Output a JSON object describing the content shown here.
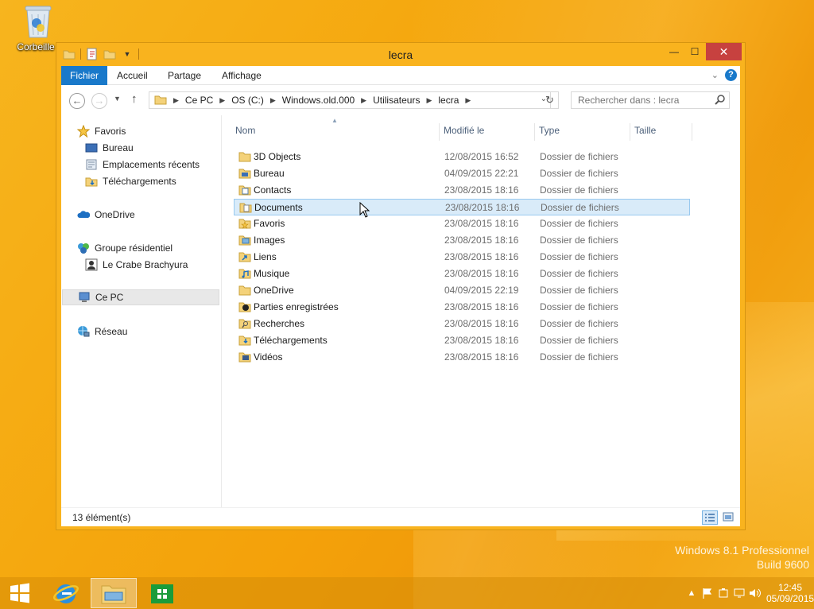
{
  "desktop": {
    "recycle_bin_label": "Corbeille",
    "watermark_line1": "Windows 8.1 Professionnel",
    "watermark_line2": "Build 9600"
  },
  "window": {
    "title": "lecra",
    "controls": {
      "minimize": "—",
      "maximize": "☐",
      "close": "✕"
    }
  },
  "ribbon": {
    "tabs": [
      {
        "label": "Fichier"
      },
      {
        "label": "Accueil"
      },
      {
        "label": "Partage"
      },
      {
        "label": "Affichage"
      }
    ],
    "help": "?"
  },
  "address": {
    "segments": [
      "Ce PC",
      "OS (C:)",
      "Windows.old.000",
      "Utilisateurs",
      "lecra"
    ],
    "search_placeholder": "Rechercher dans : lecra"
  },
  "nav": {
    "favorites_label": "Favoris",
    "favorites": [
      "Bureau",
      "Emplacements récents",
      "Téléchargements"
    ],
    "onedrive": "OneDrive",
    "homegroup": "Groupe résidentiel",
    "homegroup_user": "Le Crabe Brachyura",
    "this_pc": "Ce PC",
    "network": "Réseau"
  },
  "columns": {
    "name": "Nom",
    "modified": "Modifié le",
    "type": "Type",
    "size": "Taille"
  },
  "files": [
    {
      "name": "3D Objects",
      "date": "12/08/2015 16:52",
      "type": "Dossier de fichiers",
      "icon": "folder-icon"
    },
    {
      "name": "Bureau",
      "date": "04/09/2015 22:21",
      "type": "Dossier de fichiers",
      "icon": "desktop-folder-icon"
    },
    {
      "name": "Contacts",
      "date": "23/08/2015 18:16",
      "type": "Dossier de fichiers",
      "icon": "contacts-folder-icon"
    },
    {
      "name": "Documents",
      "date": "23/08/2015 18:16",
      "type": "Dossier de fichiers",
      "icon": "documents-folder-icon"
    },
    {
      "name": "Favoris",
      "date": "23/08/2015 18:16",
      "type": "Dossier de fichiers",
      "icon": "favorites-folder-icon"
    },
    {
      "name": "Images",
      "date": "23/08/2015 18:16",
      "type": "Dossier de fichiers",
      "icon": "pictures-folder-icon"
    },
    {
      "name": "Liens",
      "date": "23/08/2015 18:16",
      "type": "Dossier de fichiers",
      "icon": "links-folder-icon"
    },
    {
      "name": "Musique",
      "date": "23/08/2015 18:16",
      "type": "Dossier de fichiers",
      "icon": "music-folder-icon"
    },
    {
      "name": "OneDrive",
      "date": "04/09/2015 22:19",
      "type": "Dossier de fichiers",
      "icon": "folder-icon"
    },
    {
      "name": "Parties enregistrées",
      "date": "23/08/2015 18:16",
      "type": "Dossier de fichiers",
      "icon": "saved-games-folder-icon"
    },
    {
      "name": "Recherches",
      "date": "23/08/2015 18:16",
      "type": "Dossier de fichiers",
      "icon": "searches-folder-icon"
    },
    {
      "name": "Téléchargements",
      "date": "23/08/2015 18:16",
      "type": "Dossier de fichiers",
      "icon": "downloads-folder-icon"
    },
    {
      "name": "Vidéos",
      "date": "23/08/2015 18:16",
      "type": "Dossier de fichiers",
      "icon": "videos-folder-icon"
    }
  ],
  "selected_file": "Documents",
  "status": {
    "count": "13 élément(s)"
  },
  "taskbar": {
    "clock_time": "12:45",
    "clock_date": "05/09/2015"
  },
  "colors": {
    "accent": "#1979ca",
    "desktop": "#f5a80f",
    "close": "#c7413f",
    "selection": "#d9ebf9"
  }
}
